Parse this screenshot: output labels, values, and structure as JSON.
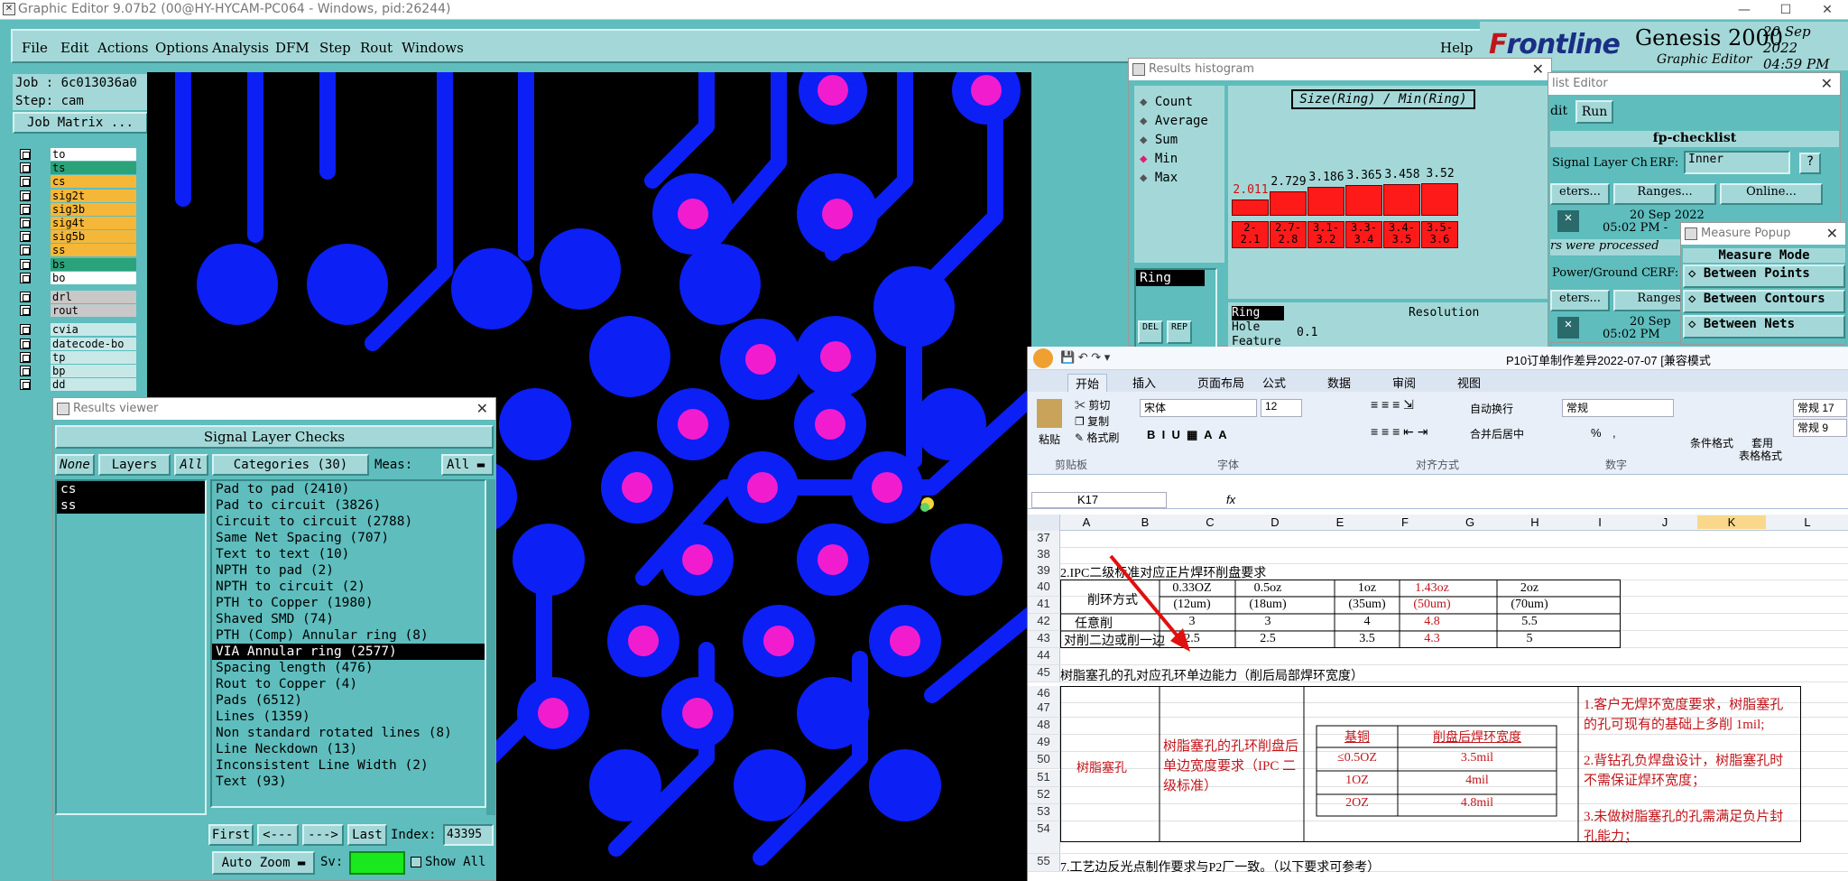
{
  "window": {
    "title": "Graphic Editor 9.07b2 (00@HY-HYCAM-PC064 - Windows, pid:26244)"
  },
  "menubar": {
    "items": [
      "File",
      "Edit",
      "Actions",
      "Options",
      "Analysis",
      "DFM",
      "Step",
      "Rout",
      "Windows"
    ],
    "help": "Help"
  },
  "brand": {
    "logo_prefix": "F",
    "logo_rest": "rontline",
    "product": "Genesis 2000",
    "subtitle": "Graphic Editor",
    "date": "20 Sep 2022",
    "time": "04:59 PM"
  },
  "job": {
    "job": "Job : 6c013036a0",
    "step": "Step: cam",
    "matrix_button": "Job Matrix ..."
  },
  "layers": [
    {
      "name": "to",
      "color": "#ffffff"
    },
    {
      "name": "ts",
      "color": "#2aa37a"
    },
    {
      "name": "cs",
      "color": "#f5b73a"
    },
    {
      "name": "sig2t",
      "color": "#f5b73a"
    },
    {
      "name": "sig3b",
      "color": "#f5b73a"
    },
    {
      "name": "sig4t",
      "color": "#f5b73a"
    },
    {
      "name": "sig5b",
      "color": "#f5b73a"
    },
    {
      "name": "ss",
      "color": "#f5b73a"
    },
    {
      "name": "bs",
      "color": "#2aa37a"
    },
    {
      "name": "bo",
      "color": "#ffffff"
    },
    {
      "name": "drl",
      "color": "#c8c8c8"
    },
    {
      "name": "rout",
      "color": "#c8c8c8"
    },
    {
      "name": "cvia",
      "color": "#c8e8e8"
    },
    {
      "name": "datecode-bo",
      "color": "#c8e8e8"
    },
    {
      "name": "tp",
      "color": "#c8e8e8"
    },
    {
      "name": "bp",
      "color": "#c8e8e8"
    },
    {
      "name": "dd",
      "color": "#c8e8e8"
    }
  ],
  "results_viewer": {
    "title": "Results viewer",
    "header": "Signal Layer Checks",
    "none_btn": "None",
    "layers_btn": "Layers",
    "all_btn": "All",
    "categories_btn": "Categories (30)",
    "meas_label": "Meas:",
    "meas_value": "All",
    "layer_list": [
      "cs",
      "ss"
    ],
    "categories": [
      "Pad to pad (2410)",
      "Pad to circuit (3826)",
      "Circuit to circuit (2788)",
      "Same Net Spacing (707)",
      "Text to text (10)",
      "NPTH to pad (2)",
      "NPTH to circuit (2)",
      "PTH to Copper (1980)",
      "Shaved SMD (74)",
      "PTH (Comp) Annular ring (8)",
      "VIA Annular ring (2577)",
      "Spacing length (476)",
      "Rout to Copper (4)",
      "Pads (6512)",
      "Lines (1359)",
      "Non standard rotated lines (8)",
      "Line Neckdown (13)",
      "Inconsistent Line Width (2)",
      "Text (93)"
    ],
    "selected_index": 10,
    "first": "First",
    "prev": "<---",
    "next": "--->",
    "last": "Last",
    "index_label": "Index:",
    "index_value": "43395",
    "auto_zoom": "Auto Zoom",
    "sv_label": "Sv:",
    "show_all": "Show All"
  },
  "histogram": {
    "title": "Results histogram",
    "modes": [
      "Count",
      "Average",
      "Sum",
      "Min",
      "Max"
    ],
    "selected_mode": "Min",
    "chart_title": "Size(Ring) / Min(Ring)",
    "list_item": "Ring",
    "bars": [
      {
        "value": "2.011",
        "range_top": "2-",
        "range_bot": "2.1",
        "red_label": true
      },
      {
        "value": "2.729",
        "range_top": "2.7-",
        "range_bot": "2.8",
        "red_label": false
      },
      {
        "value": "3.186",
        "range_top": "3.1-",
        "range_bot": "3.2",
        "red_label": false
      },
      {
        "value": "3.365",
        "range_top": "3.3-",
        "range_bot": "3.4",
        "red_label": false
      },
      {
        "value": "3.458",
        "range_top": "3.4-",
        "range_bot": "3.5",
        "red_label": false
      },
      {
        "value": "3.52",
        "range_top": "3.5-",
        "range_bot": "3.6",
        "red_label": false
      }
    ],
    "attrs": [
      "Ring",
      "Hole",
      "Feature"
    ],
    "resolution_label": "Resolution",
    "resolution_value": "0.1",
    "btn_del": "DEL",
    "btn_rep": "REP"
  },
  "checklist": {
    "title": "list Editor",
    "menu_edit": "dit",
    "menu_run": "Run",
    "name": "fp-checklist",
    "row1_label": "Signal Layer Ch",
    "erf_label": "ERF:",
    "erf_value": "Inner",
    "help": "?",
    "btn_params": "eters...",
    "btn_ranges": "Ranges...",
    "btn_online": "Online...",
    "date1": "20 Sep 2022",
    "time1": "05:02 PM -",
    "msg": "rs were processed",
    "row2_label": "Power/Ground C",
    "erf2": "ERF:",
    "btn_params2": "eters...",
    "btn_ranges2": "Ranges...",
    "date2": "20 Sep",
    "time2": "05:02 PM"
  },
  "measure": {
    "title": "Measure Popup",
    "mode_label": "Measure Mode",
    "options": [
      "Between Points",
      "Between Contours",
      "Between Nets"
    ]
  },
  "excel": {
    "doc_title": "P10订单制作差异2022-07-07 [兼容模式",
    "tabs": [
      "开始",
      "插入",
      "页面布局",
      "公式",
      "数据",
      "审阅",
      "视图"
    ],
    "clipboard": {
      "paste": "粘贴",
      "cut": "剪切",
      "copy": "复制",
      "format_painter": "格式刷",
      "group": "剪贴板"
    },
    "font": {
      "name": "宋体",
      "size": "12",
      "group": "字体"
    },
    "align": {
      "wrap": "自动换行",
      "merge": "合并后居中",
      "group": "对齐方式"
    },
    "number": {
      "format": "常规",
      "percent": "%",
      "comma": ",",
      "group": "数字"
    },
    "styles": {
      "cond": "条件格式",
      "table": "套用",
      "table2": "表格格式",
      "normal1": "常规 17",
      "normal2": "常规 9"
    },
    "name_box": "K17",
    "fx": "fx",
    "columns": [
      "A",
      "B",
      "C",
      "D",
      "E",
      "F",
      "G",
      "H",
      "I",
      "J",
      "K",
      "L"
    ],
    "rows": {
      "r37": "37",
      "r38": "38",
      "r39": "39",
      "r40": "40",
      "r41": "41",
      "r42": "42",
      "r43": "43",
      "r44": "44",
      "r45": "45",
      "r46": "46",
      "r47": "47",
      "r48": "48",
      "r49": "49",
      "r50": "50",
      "r51": "51",
      "r52": "52",
      "r53": "53",
      "r54": "54",
      "r55": "55"
    },
    "ipc_title": "2.IPC二级标准对应正片焊环削盘要求",
    "method_label": "削环方式",
    "weights": [
      "0.33OZ",
      "0.5oz",
      "1oz",
      "1.43oz",
      "2oz"
    ],
    "thick": [
      "(12um)",
      "(18um)",
      "(35um)",
      "(50um)",
      "(70um)"
    ],
    "row_any": "任意削",
    "any_vals": [
      "3",
      "3",
      "4",
      "4.8",
      "5.5"
    ],
    "row_pair": "对削二边或削一边",
    "pair_vals": [
      "2.5",
      "2.5",
      "3.5",
      "4.3",
      "5"
    ],
    "resin_title": "树脂塞孔的孔对应孔环单边能力（削后局部焊环宽度）",
    "resin_label": "树脂塞孔",
    "resin_desc": "树脂塞孔的孔环削盘后单边宽度要求（IPC 二级标准）",
    "inner_head": [
      "基铜",
      "削盘后焊环宽度"
    ],
    "inner_rows": [
      [
        "≤0.5OZ",
        "3.5mil"
      ],
      [
        "1OZ",
        "4mil"
      ],
      [
        "2OZ",
        "4.8mil"
      ]
    ],
    "notes": [
      "1.客户无焊环宽度要求，树脂塞孔的孔可现有的基础上多削 1mil;",
      "2.背钻孔负焊盘设计，树脂塞孔时不需保证焊环宽度；",
      "3.未做树脂塞孔的孔需满足负片封孔能力；"
    ],
    "row55": "7.工艺边反光点制作要求与P2厂一致。（以下要求可参考）"
  }
}
